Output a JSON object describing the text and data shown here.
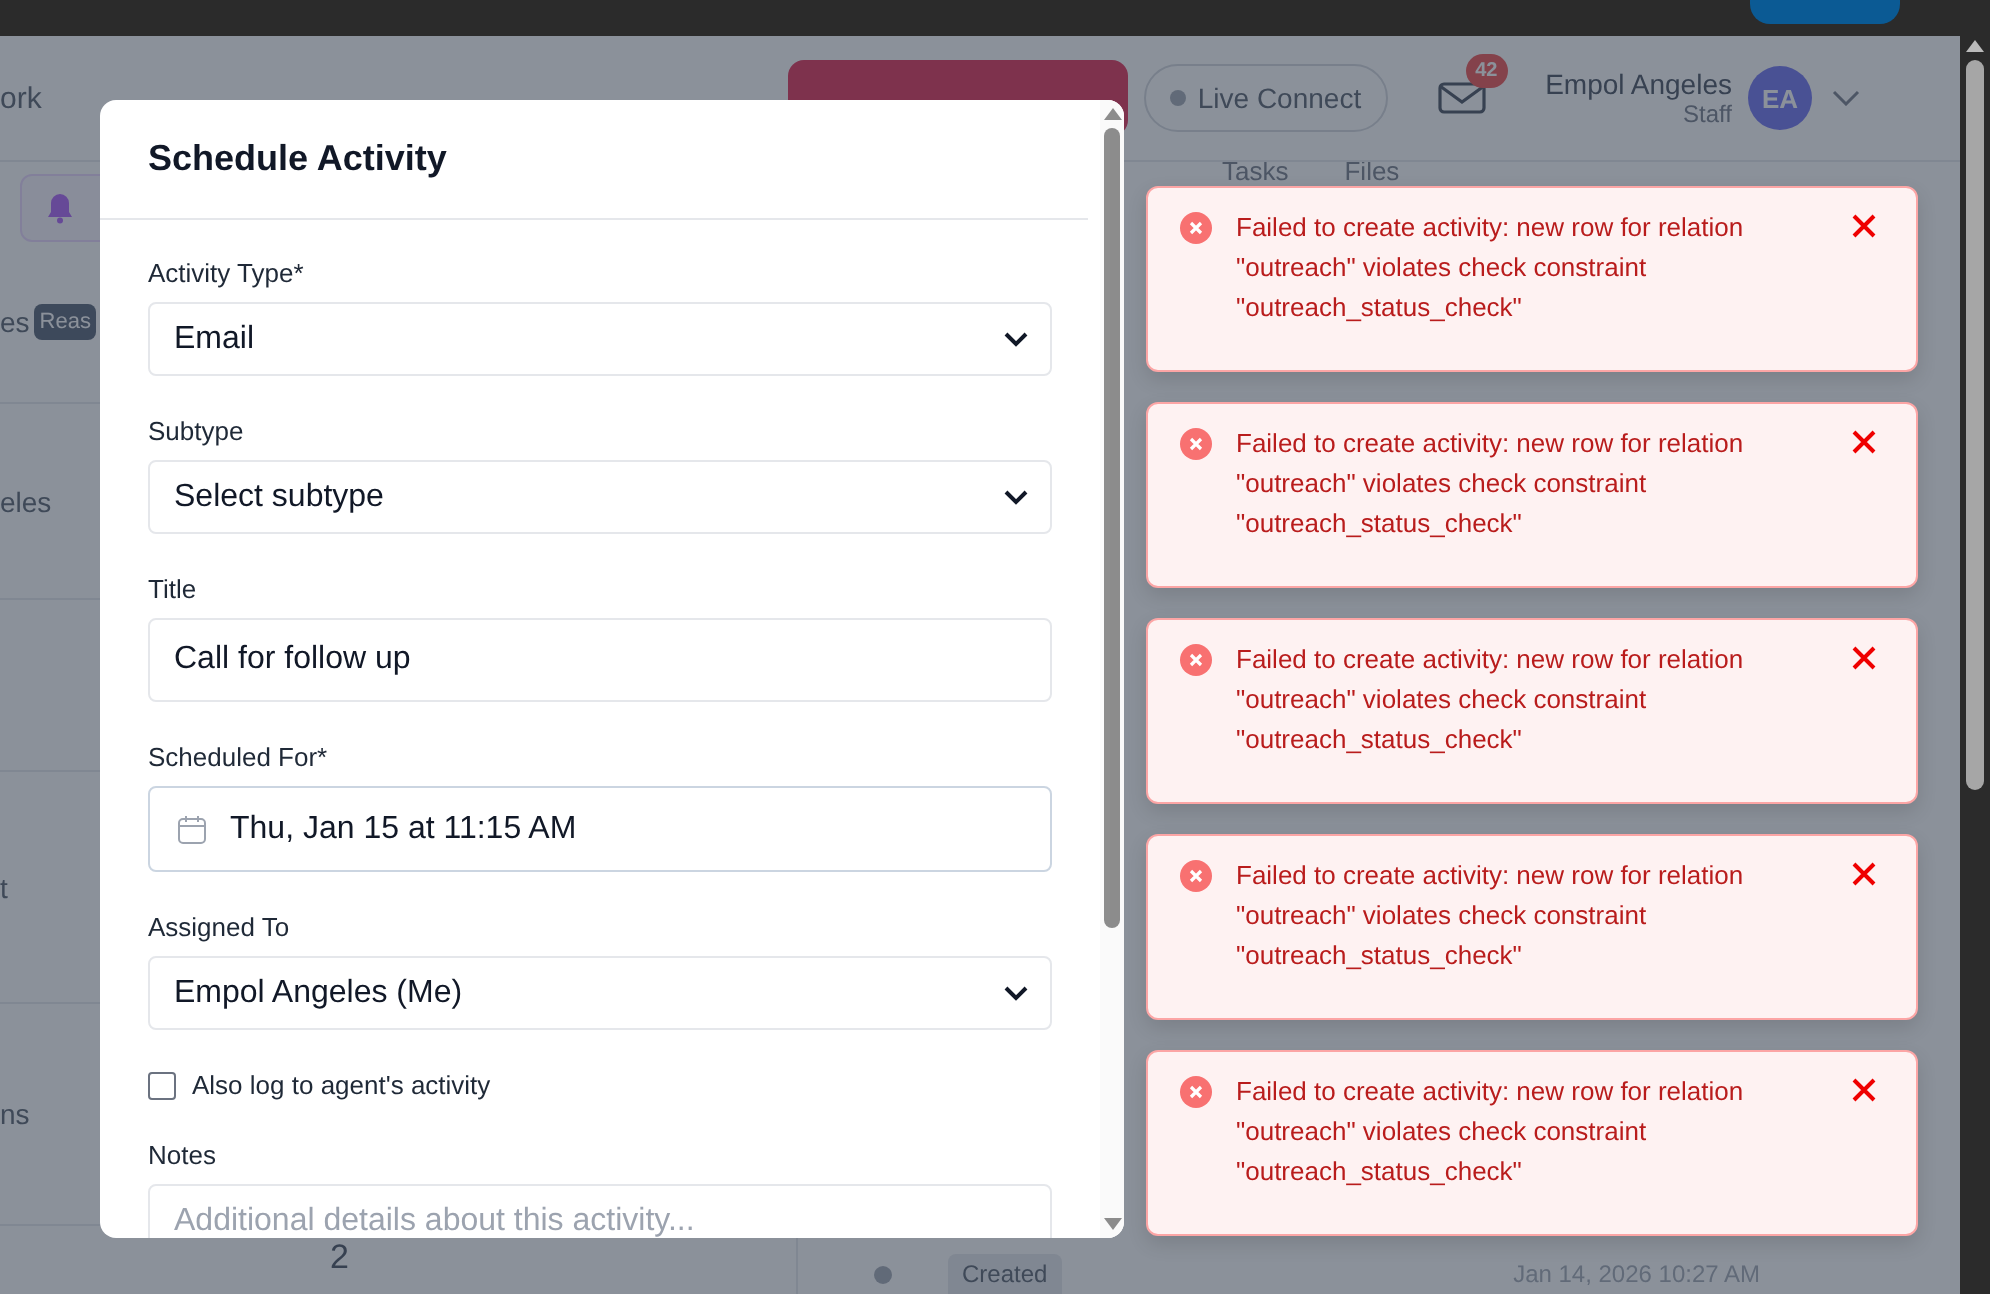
{
  "header": {
    "nav": [
      {
        "label": "ork"
      }
    ],
    "live_connect": "Live Connect",
    "mail_count": "42",
    "user": {
      "name": "Empol Angeles",
      "role": "Staff",
      "initials": "EA"
    }
  },
  "background": {
    "tabs": [
      "Tasks",
      "Files"
    ],
    "rows": [
      {
        "label": "es",
        "tag": "Reas"
      },
      {
        "label": "eles"
      },
      {},
      {
        "label": "t"
      },
      {
        "label": "ns"
      }
    ],
    "count": "2",
    "entry": {
      "tag": "Created",
      "time": "Jan 14, 2026 10:27 AM"
    }
  },
  "modal": {
    "title": "Schedule Activity",
    "fields": [
      {
        "kind": "select",
        "label": "Activity Type*",
        "value": "Email"
      },
      {
        "kind": "select",
        "label": "Subtype",
        "value": "Select subtype"
      },
      {
        "kind": "input",
        "label": "Title",
        "value": "Call for follow up"
      },
      {
        "kind": "date",
        "label": "Scheduled For*",
        "value": "Thu, Jan 15 at 11:15 AM"
      },
      {
        "kind": "select",
        "label": "Assigned To",
        "value": "Empol Angeles (Me)"
      }
    ],
    "checkbox": {
      "label": "Also log to agent's activity",
      "checked": false
    },
    "notes": {
      "label": "Notes",
      "placeholder": "Additional details about this activity..."
    }
  },
  "toasts": [
    {
      "message": "Failed to create activity: new row for relation \"outreach\" violates check constraint \"outreach_status_check\""
    },
    {
      "message": "Failed to create activity: new row for relation \"outreach\" violates check constraint \"outreach_status_check\""
    },
    {
      "message": "Failed to create activity: new row for relation \"outreach\" violates check constraint \"outreach_status_check\""
    },
    {
      "message": "Failed to create activity: new row for relation \"outreach\" violates check constraint \"outreach_status_check\""
    },
    {
      "message": "Failed to create activity: new row for relation \"outreach\" violates check constraint \"outreach_status_check\""
    }
  ]
}
